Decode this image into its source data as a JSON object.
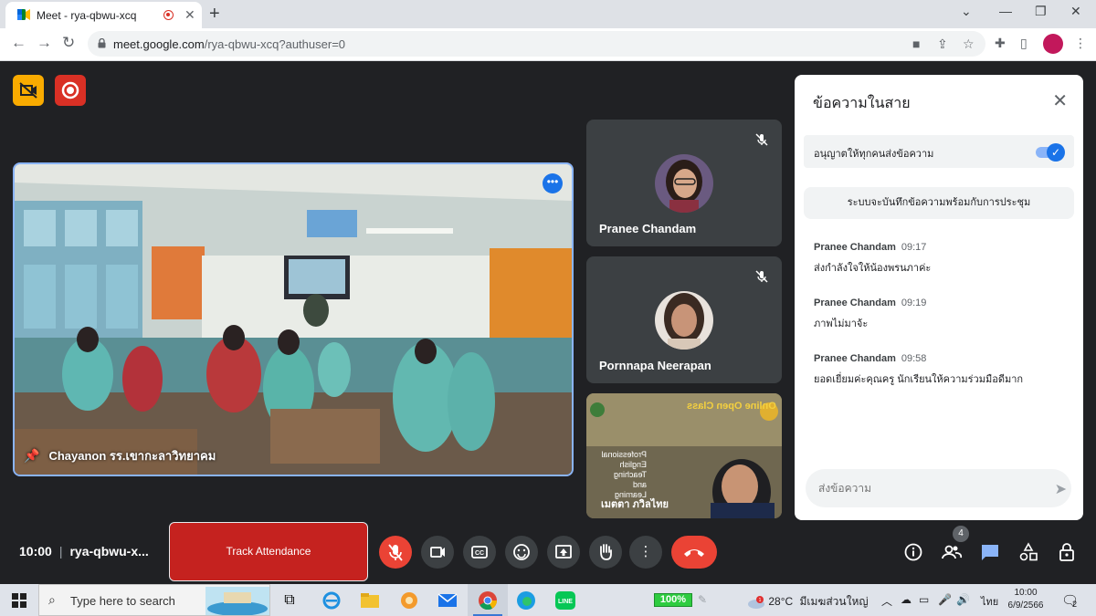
{
  "browser": {
    "tab_title": "Meet - rya-qbwu-xcq",
    "url_host": "meet.google.com",
    "url_path": "/rya-qbwu-xcq?authuser=0"
  },
  "meeting": {
    "time": "10:00",
    "separator": "|",
    "code": "rya-qbwu-x...",
    "track_attendance_label": "Track Attendance",
    "people_count": "4"
  },
  "tiles": {
    "main": {
      "name": "Chayanon รร.เขากะลาวิทยาคม"
    },
    "side": [
      {
        "name": "Pranee Chandam"
      },
      {
        "name": "Pornnapa Neerapan"
      }
    ],
    "slide": {
      "banner": "Online Open Class",
      "side_text": [
        "Professional",
        "English",
        "Teaching",
        "and",
        "Learning"
      ],
      "caption": "เมตตา ภวิลไทย"
    }
  },
  "chat": {
    "title": "ข้อความในสาย",
    "allow_label": "อนุญาตให้ทุกคนส่งข้อความ",
    "allow_enabled": true,
    "notice": "ระบบจะบันทึกข้อความพร้อมกับการประชุม",
    "messages": [
      {
        "sender": "Pranee Chandam",
        "time": "09:17",
        "text": "ส่งกำลังใจให้น้องพรนภาค่ะ"
      },
      {
        "sender": "Pranee Chandam",
        "time": "09:19",
        "text": "ภาพไม่มาจ้ะ"
      },
      {
        "sender": "Pranee Chandam",
        "time": "09:58",
        "text": "ยอดเยี่ยมค่ะคุณครู นักเรียนให้ความร่วมมือดีมาก"
      }
    ],
    "input_placeholder": "ส่งข้อความ"
  },
  "taskbar": {
    "search_placeholder": "Type here to search",
    "battery": "100%",
    "weather_temp": "28°C",
    "weather_text": "มีเมฆส่วนใหญ่",
    "weather_alert": "1",
    "language": "ไทย",
    "clock_time": "10:00",
    "clock_date": "6/9/2566",
    "notification_count": "2"
  },
  "colors": {
    "meet_bg": "#202124",
    "tile_bg": "#3c4043",
    "active_border": "#8ab4f8",
    "accent_blue": "#1a73e8",
    "danger_red": "#ea4335",
    "host_badge_yellow": "#f9ab00",
    "host_badge_red": "#d93025"
  }
}
